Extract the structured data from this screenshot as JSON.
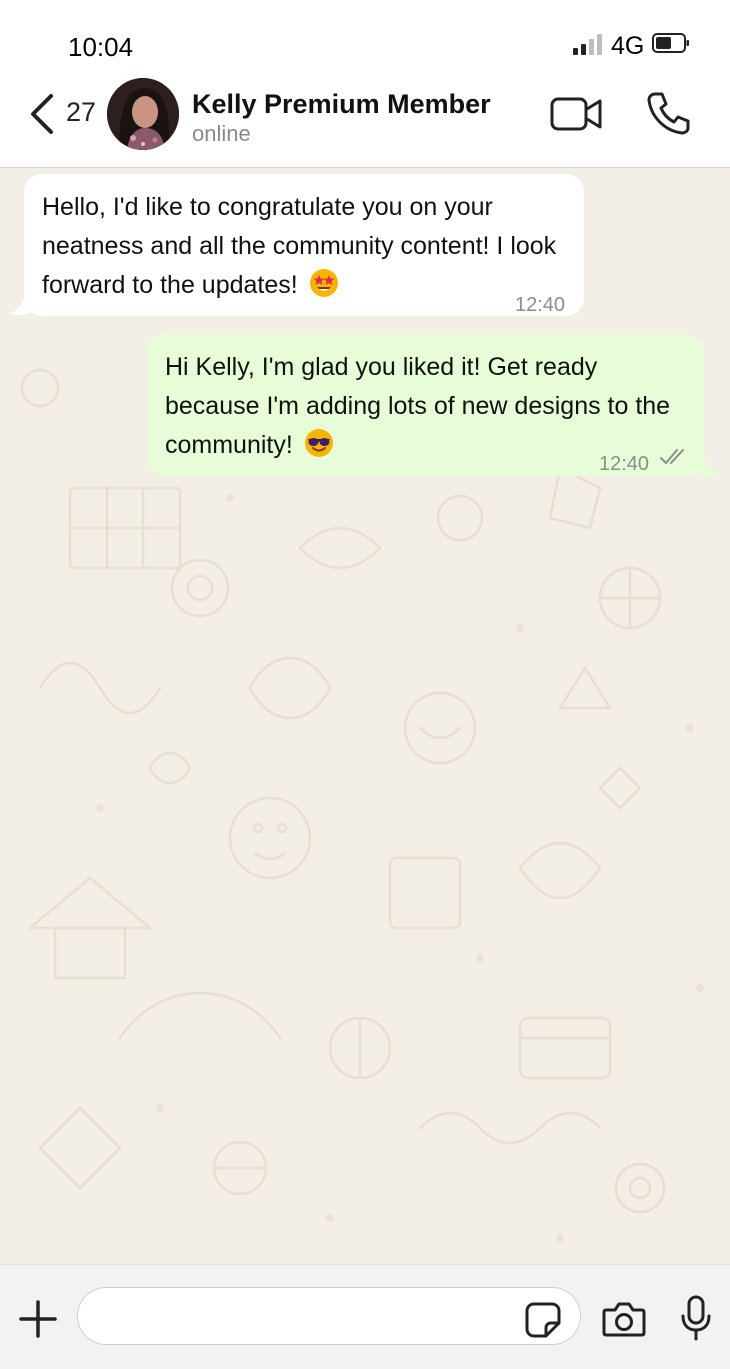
{
  "status_bar": {
    "time": "10:04",
    "network": "4G"
  },
  "header": {
    "back_count": "27",
    "contact_name": "Kelly Premium Member",
    "contact_status": "online"
  },
  "messages": [
    {
      "direction": "incoming",
      "text": "Hello, I'd like to congratulate you on your neatness and all the community content! I look forward to the updates!",
      "emoji": "star-struck-emoji",
      "time": "12:40"
    },
    {
      "direction": "outgoing",
      "text": "Hi Kelly, I'm glad you liked it! Get ready because I'm adding lots of new designs to the community!",
      "emoji": "sunglasses-emoji",
      "time": "12:40",
      "status": "read"
    }
  ],
  "composer": {
    "input_value": "",
    "placeholder": ""
  },
  "colors": {
    "outgoing_bubble": "#e6fdd8",
    "incoming_bubble": "#ffffff",
    "chat_background": "#f3efe6",
    "header_background": "#ffffff",
    "composer_background": "#f2f2f2"
  }
}
